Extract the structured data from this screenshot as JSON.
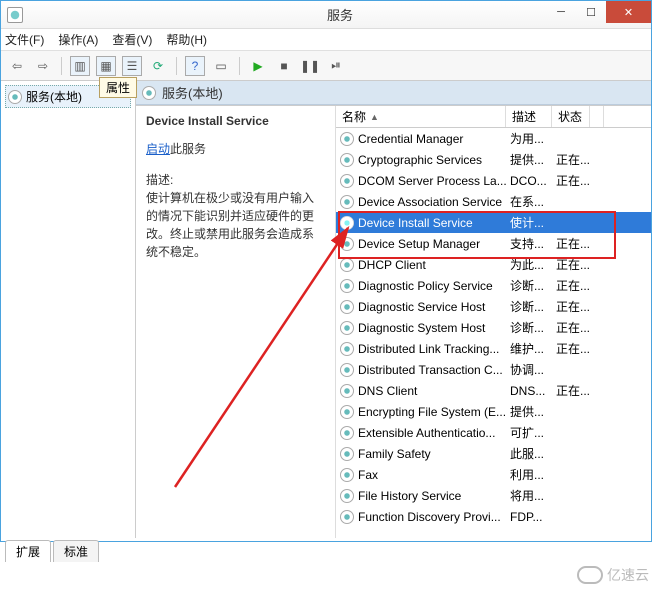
{
  "window": {
    "title": "服务"
  },
  "menubar": [
    "文件(F)",
    "操作(A)",
    "查看(V)",
    "帮助(H)"
  ],
  "tooltip": "属性",
  "leftnode": "服务(本地)",
  "rp_header": "服务(本地)",
  "detail": {
    "name": "Device Install Service",
    "action_link": "启动",
    "action_suffix": "此服务",
    "desc_label": "描述:",
    "desc": "使计算机在极少或没有用户输入的情况下能识别并适应硬件的更改。终止或禁用此服务会造成系统不稳定。"
  },
  "columns": {
    "name": "名称",
    "desc": "描述",
    "status": "状态"
  },
  "services": [
    {
      "n": "Credential Manager",
      "d": "为用...",
      "s": ""
    },
    {
      "n": "Cryptographic Services",
      "d": "提供...",
      "s": "正在..."
    },
    {
      "n": "DCOM Server Process La...",
      "d": "DCO...",
      "s": "正在..."
    },
    {
      "n": "Device Association Service",
      "d": "在系...",
      "s": ""
    },
    {
      "n": "Device Install Service",
      "d": "使计...",
      "s": "",
      "sel": true
    },
    {
      "n": "Device Setup Manager",
      "d": "支持...",
      "s": "正在..."
    },
    {
      "n": "DHCP Client",
      "d": "为此...",
      "s": "正在..."
    },
    {
      "n": "Diagnostic Policy Service",
      "d": "诊断...",
      "s": "正在..."
    },
    {
      "n": "Diagnostic Service Host",
      "d": "诊断...",
      "s": "正在..."
    },
    {
      "n": "Diagnostic System Host",
      "d": "诊断...",
      "s": "正在..."
    },
    {
      "n": "Distributed Link Tracking...",
      "d": "维护...",
      "s": "正在..."
    },
    {
      "n": "Distributed Transaction C...",
      "d": "协调...",
      "s": ""
    },
    {
      "n": "DNS Client",
      "d": "DNS...",
      "s": "正在..."
    },
    {
      "n": "Encrypting File System (E...",
      "d": "提供...",
      "s": ""
    },
    {
      "n": "Extensible Authenticatio...",
      "d": "可扩...",
      "s": ""
    },
    {
      "n": "Family Safety",
      "d": "此服...",
      "s": ""
    },
    {
      "n": "Fax",
      "d": "利用...",
      "s": ""
    },
    {
      "n": "File History Service",
      "d": "将用...",
      "s": ""
    },
    {
      "n": "Function Discovery Provi...",
      "d": "FDP...",
      "s": ""
    }
  ],
  "tabs": [
    "扩展",
    "标准"
  ],
  "watermark": "亿速云"
}
